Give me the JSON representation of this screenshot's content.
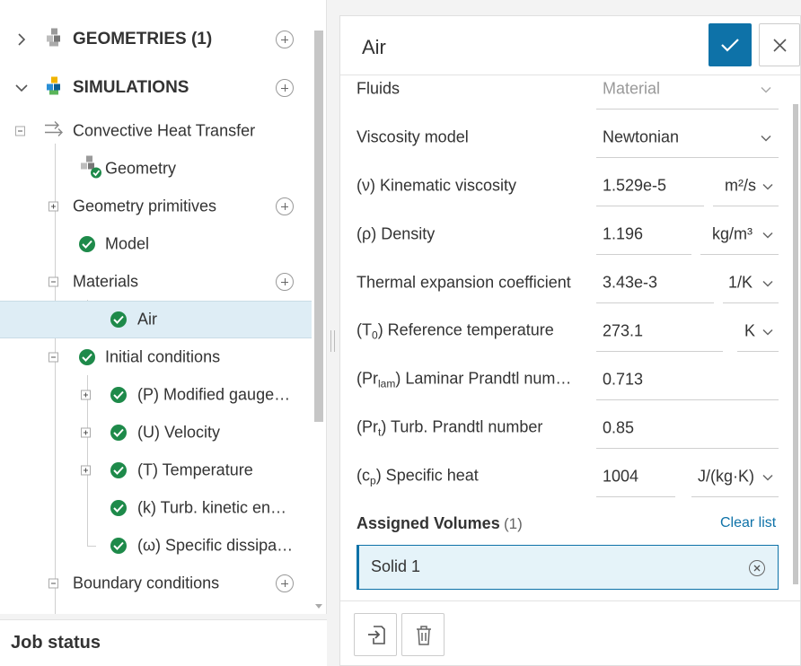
{
  "tree": {
    "geometries": {
      "label": "GEOMETRIES (1)"
    },
    "simulations": {
      "label": "SIMULATIONS"
    },
    "simulation": {
      "label": "Convective Heat Transfer"
    },
    "items": {
      "geometry": "Geometry",
      "geometry_primitives": "Geometry primitives",
      "model": "Model",
      "materials": "Materials",
      "air": "Air",
      "initial_conditions": "Initial conditions",
      "p": "(P) Modified gauge…",
      "u": "(U) Velocity",
      "t": "(T) Temperature",
      "k": "(k) Turb. kinetic en…",
      "omega": "(ω) Specific dissipa…",
      "boundary_conditions": "Boundary conditions"
    }
  },
  "job_status": {
    "label": "Job status"
  },
  "panel": {
    "title": "Air",
    "fields": {
      "fluids": {
        "label": "Fluids",
        "value": "Material"
      },
      "viscosity_model": {
        "label": "Viscosity model",
        "value": "Newtonian"
      },
      "kinematic_viscosity": {
        "label": "(ν) Kinematic viscosity",
        "value": "1.529e-5",
        "unit": "m²/s"
      },
      "density": {
        "label": "(ρ) Density",
        "value": "1.196",
        "unit": "kg/m³"
      },
      "thermal_expansion": {
        "label": "Thermal expansion coefficient",
        "value": "3.43e-3",
        "unit": "1/K"
      },
      "ref_temperature": {
        "label_pre": "(T",
        "label_sub": "0",
        "label_post": ") Reference temperature",
        "value": "273.1",
        "unit": "K"
      },
      "laminar_prandtl": {
        "label_pre": "(Pr",
        "label_sub": "lam",
        "label_post": ") Laminar Prandtl num…",
        "value": "0.713"
      },
      "turb_prandtl": {
        "label_pre": "(Pr",
        "label_sub": "t",
        "label_post": ") Turb. Prandtl number",
        "value": "0.85"
      },
      "specific_heat": {
        "label_pre": "(c",
        "label_sub": "p",
        "label_post": ") Specific heat",
        "value": "1004",
        "unit": "J/(kg·K)"
      }
    },
    "assigned_volumes": {
      "title": "Assigned Volumes",
      "count": "(1)",
      "clear_label": "Clear list",
      "items": [
        "Solid 1"
      ]
    }
  },
  "colors": {
    "accent": "#0e72a8",
    "check": "#1e8a4a",
    "selected_row": "#deedf5"
  },
  "icons": [
    "chevron-right-icon",
    "chevron-down-icon",
    "cubes-icon",
    "simulation-cubes-icon",
    "flow-arrows-icon",
    "check-circle-icon",
    "plus-circle-icon",
    "checkmark-icon",
    "close-icon",
    "caret-down-icon",
    "import-icon",
    "trash-icon"
  ]
}
